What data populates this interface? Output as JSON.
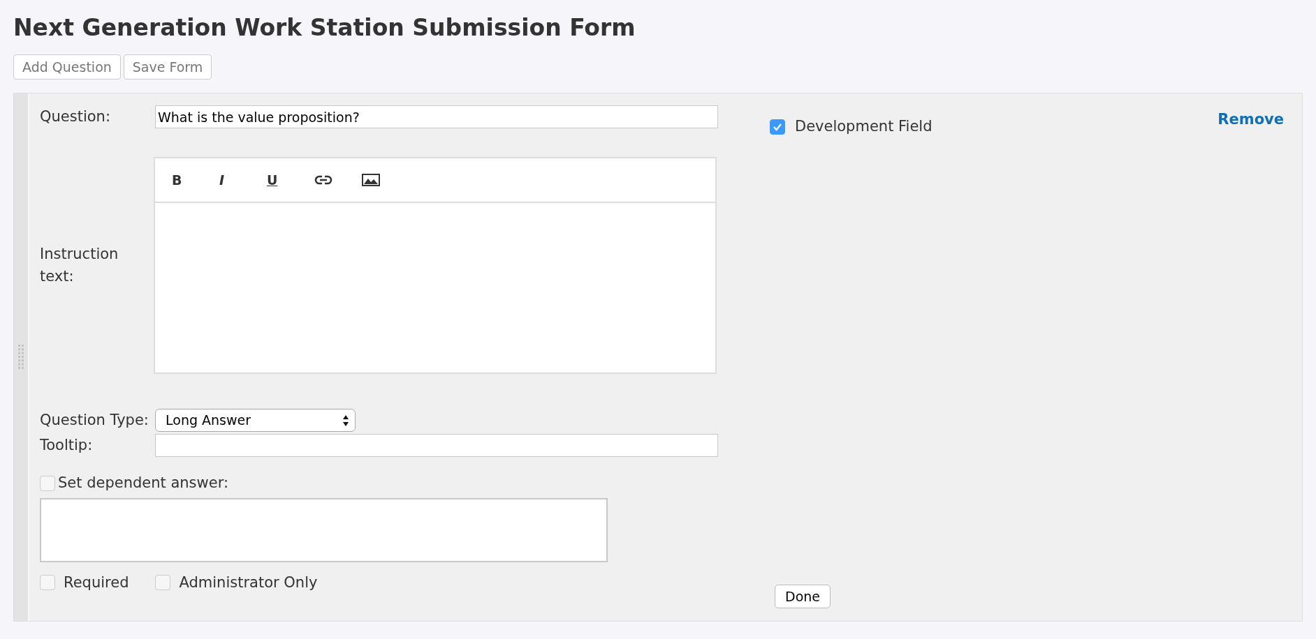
{
  "title": "Next Generation Work Station Submission Form",
  "toolbar_buttons": [
    "Add Question",
    "Save Form"
  ],
  "question": {
    "label": "Question:",
    "value": "What is the value proposition?"
  },
  "instruction": {
    "label": "Instruction text:",
    "editor_tools": [
      {
        "kind": "bold",
        "label": "B"
      },
      {
        "kind": "italic",
        "label": "I"
      },
      {
        "kind": "underline",
        "label": "U"
      },
      {
        "kind": "link"
      },
      {
        "kind": "image"
      }
    ]
  },
  "question_type": {
    "label": "Question Type:",
    "value": "Long Answer"
  },
  "tooltip": {
    "label": "Tooltip:"
  },
  "dependent_answer": {
    "label": "Set dependent answer:",
    "checked": false
  },
  "options": [
    {
      "label": "Required",
      "checked": false
    },
    {
      "label": "Administrator Only",
      "checked": false
    }
  ],
  "development_field": {
    "label": "Development Field",
    "checked": true
  },
  "remove_link": "Remove",
  "done_button": "Done"
}
